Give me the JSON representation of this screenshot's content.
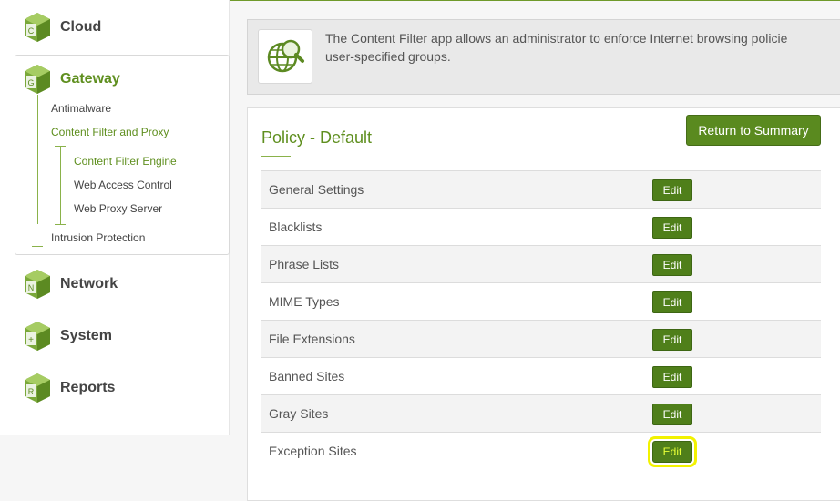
{
  "sidebar": {
    "cloud": {
      "label": "Cloud",
      "letter": "C"
    },
    "gateway": {
      "label": "Gateway",
      "letter": "G",
      "children": {
        "antimalware": "Antimalware",
        "content_filter": "Content Filter and Proxy",
        "content_filter_engine": "Content Filter Engine",
        "web_access_control": "Web Access Control",
        "web_proxy_server": "Web Proxy Server",
        "intrusion_protection": "Intrusion Protection"
      }
    },
    "network": {
      "label": "Network",
      "letter": "N"
    },
    "system": {
      "label": "System",
      "letter": "+"
    },
    "reports": {
      "label": "Reports",
      "letter": "R"
    }
  },
  "banner": {
    "line1": "The Content Filter app allows an administrator to enforce Internet browsing policie",
    "line2": "user-specified groups.",
    "icon": "globe-search-icon"
  },
  "panel": {
    "title": "Policy - Default",
    "return_label": "Return to Summary",
    "edit_label": "Edit",
    "rows": [
      "General Settings",
      "Blacklists",
      "Phrase Lists",
      "MIME Types",
      "File Extensions",
      "Banned Sites",
      "Gray Sites",
      "Exception Sites"
    ]
  },
  "colors": {
    "accent": "#5f8f1f",
    "button": "#4f7f1a",
    "highlight": "#f2f200"
  }
}
